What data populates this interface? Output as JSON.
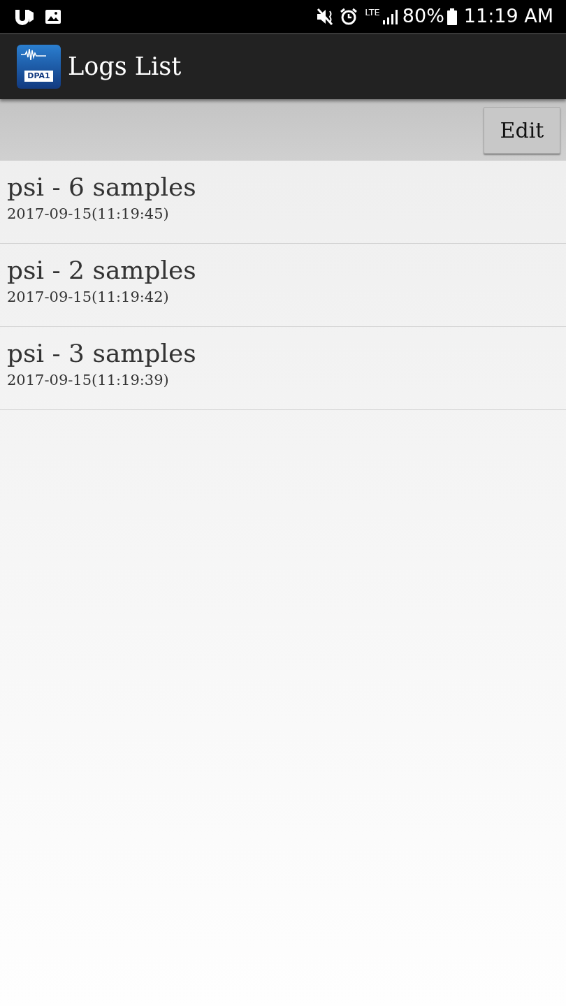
{
  "status_bar": {
    "network": "LTE",
    "battery": "80%",
    "time": "11:19 AM"
  },
  "app_bar": {
    "icon_label": "DPA1",
    "title": "Logs List"
  },
  "toolbar": {
    "buttons": [
      "Edit"
    ]
  },
  "logs": [
    {
      "title": "psi - 6 samples",
      "timestamp": "2017-09-15(11:19:45)"
    },
    {
      "title": "psi - 2 samples",
      "timestamp": "2017-09-15(11:19:42)"
    },
    {
      "title": "psi - 3 samples",
      "timestamp": "2017-09-15(11:19:39)"
    }
  ]
}
